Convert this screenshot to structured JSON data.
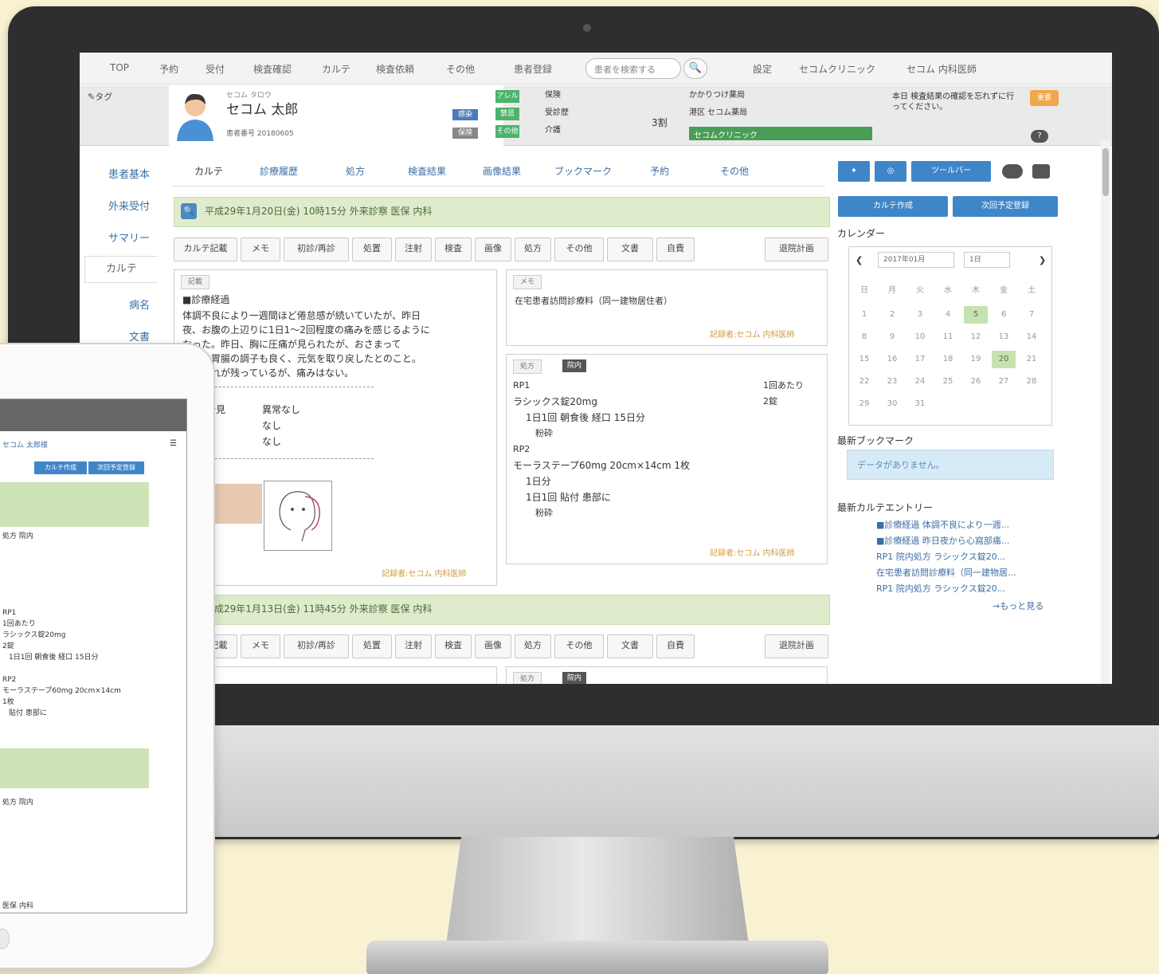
{
  "nav": {
    "items": [
      "TOP",
      "予約",
      "受付",
      "検査確認",
      "カルテ",
      "検査依頼",
      "その他",
      "患者登録"
    ],
    "search_placeholder": "患者を検索する",
    "right_items": [
      "設定",
      "セコムクリニック",
      "セコム 内科医師"
    ]
  },
  "patient": {
    "tag": "タグ",
    "kana": "セコム タロウ",
    "name": "セコム 太郎",
    "id_line": "患者番号 20180605",
    "badges": [
      "感染",
      "保険"
    ],
    "status_badges": [
      "アレルギー",
      "禁忌",
      "その他"
    ],
    "info_labels": [
      "保険",
      "受診歴",
      "介護"
    ],
    "ratio": "3割",
    "pharmacy_label": "かかりつけ薬局",
    "pharmacy_name": "港区 セコム薬局",
    "green_label": "セコムクリニック",
    "note": "本日 検査結果の確認を忘れずに行ってください。",
    "orange_badge": "重要",
    "help": "?"
  },
  "sidebar": {
    "items": [
      "患者基本",
      "外来受付",
      "サマリー",
      "カルテ",
      "病名",
      "文書"
    ]
  },
  "tabs": [
    "カルテ",
    "診療履歴",
    "処方",
    "検査結果",
    "画像結果",
    "ブックマーク",
    "予約",
    "その他"
  ],
  "entries": [
    {
      "date": "平成29年1月20日(金) 10時15分 外来診察 医保 内科"
    },
    {
      "date": "平成29年1月13日(金) 11時45分 外来診察 医保 内科"
    }
  ],
  "toolbar": [
    "カルテ記載",
    "メモ",
    "初診/再診",
    "処置",
    "注射",
    "検査",
    "画像",
    "処方",
    "その他",
    "文書",
    "自費",
    "退院計画"
  ],
  "record": {
    "tag": "記載",
    "heading": "■診療経過",
    "lines": [
      "体調不良により一週間ほど倦怠感が続いていたが、昨日",
      "夜、お腹の上辺りに1日1〜2回程度の痛みを感じるように",
      "なった。昨日、胸に圧痛が見られたが、おさまって",
      "今朝は胃腸の調子も良く、元気を取り戻したとのこと。",
      "まだ疲れが残っているが、痛みはない。"
    ],
    "findings": [
      {
        "label": "所見",
        "value": "異常なし"
      },
      {
        "label": "",
        "value": "なし"
      },
      {
        "label": "",
        "value": "なし"
      }
    ],
    "signature": "記録者:セコム 内科医師"
  },
  "memo": {
    "tag": "メモ",
    "text": "在宅患者訪問診療料（同一建物居住者）",
    "signature": "記録者:セコム 内科医師"
  },
  "prescription": {
    "tag": "処方",
    "dark_tag": "院内",
    "rp1": "RP1",
    "rp1_count": "1回あたり",
    "drug1": "ラシックス錠20mg",
    "drug1_qty": "2錠",
    "drug1_usage": "1日1回 朝食後 経口 15日分",
    "drug1_note": "粉砕",
    "rp2": "RP2",
    "drug2": "モーラステープ60mg  20cm×14cm 1枚",
    "drug2_days": "1日分",
    "drug2_usage": "1日1回 貼付 患部に",
    "drug2_note": "粉砕",
    "signature": "記録者:セコム 内科医師"
  },
  "right": {
    "buttons_top": [
      "✦",
      "◎",
      "ツールバー"
    ],
    "buttons_second": [
      "カルテ作成",
      "次回予定登録"
    ],
    "calendar_title": "カレンダー",
    "calendar_month": "2017年01月",
    "calendar_day": "1日",
    "weekdays": [
      "日",
      "月",
      "火",
      "水",
      "木",
      "金",
      "土"
    ],
    "days": [
      "1",
      "2",
      "3",
      "4",
      "5",
      "6",
      "7",
      "8",
      "9",
      "10",
      "11",
      "12",
      "13",
      "14",
      "15",
      "16",
      "17",
      "18",
      "19",
      "20",
      "21",
      "22",
      "23",
      "24",
      "25",
      "26",
      "27",
      "28",
      "29",
      "30",
      "31"
    ],
    "bookmark_title": "最新ブックマーク",
    "no_data": "データがありません。",
    "entry_title": "最新カルテエントリー",
    "entry_links": [
      "■診療経過 体調不良により一週...",
      "■診療経過 昨日夜から心窩部痛...",
      "RP1 院内処方 ラシックス錠20...",
      "在宅患者訪問診療料（同一建物居...",
      "RP1 院内処方 ラシックス錠20..."
    ],
    "more": "→もっと見る"
  },
  "tablet": {
    "header": "セコム 太郎様",
    "buttons": [
      "カルテ作成",
      "次回予定登録"
    ],
    "lines": [
      "処方 院内",
      "RP1",
      "1回あたり",
      "ラシックス錠20mg",
      "2錠",
      "1日1回 朝食後 経口 15日分",
      "RP2",
      "モーラステープ60mg  20cm×14cm",
      "1枚",
      "貼付 患部に"
    ],
    "footer": "医保 内科"
  }
}
